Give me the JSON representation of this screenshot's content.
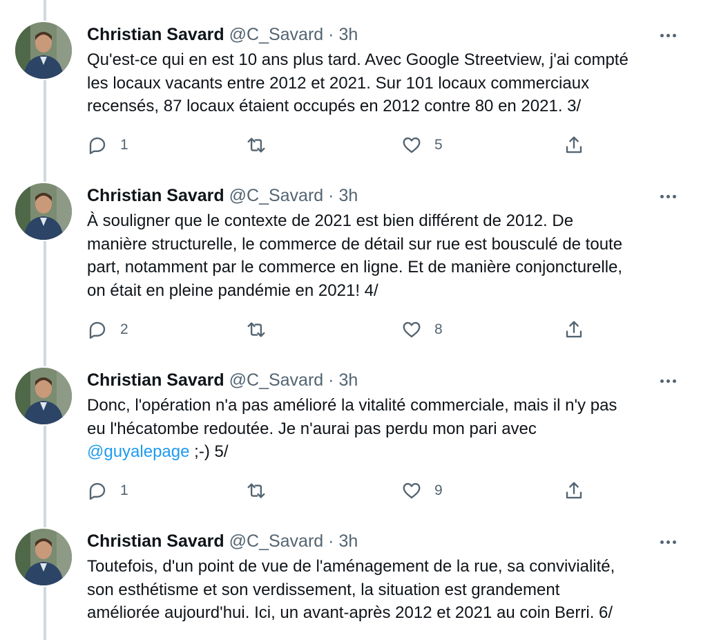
{
  "tweets": [
    {
      "name": "Christian Savard",
      "handle": "@C_Savard",
      "separator": "·",
      "time": "3h",
      "lines": [
        "Qu'est-ce qui en est 10 ans plus tard. Avec Google Streetview, j'ai compté",
        "les locaux vacants entre 2012 et 2021. Sur 101 locaux commerciaux",
        "recensés, 87 locaux étaient occupés en 2012 contre 80 en 2021. 3/"
      ],
      "reply_count": "1",
      "retweet_count": "",
      "like_count": "5"
    },
    {
      "name": "Christian Savard",
      "handle": "@C_Savard",
      "separator": "·",
      "time": "3h",
      "lines": [
        "À souligner que le contexte de 2021 est bien différent de 2012. De",
        "manière structurelle, le commerce de détail sur rue est bousculé de toute",
        "part, notamment par le commerce en ligne. Et de manière conjoncturelle,",
        "on était en pleine pandémie en 2021! 4/"
      ],
      "reply_count": "2",
      "retweet_count": "",
      "like_count": "8"
    },
    {
      "name": "Christian Savard",
      "handle": "@C_Savard",
      "separator": "·",
      "time": "3h",
      "lines": [
        "Donc, l'opération n'a pas amélioré la vitalité commerciale, mais il n'y pas",
        "eu l'hécatombe redoutée. Je n'aurai pas perdu mon pari avec"
      ],
      "mention": "@guyalepage",
      "after_mention": " ;-) 5/",
      "reply_count": "1",
      "retweet_count": "",
      "like_count": "9"
    },
    {
      "name": "Christian Savard",
      "handle": "@C_Savard",
      "separator": "·",
      "time": "3h",
      "lines": [
        "Toutefois, d'un point de vue de l'aménagement de la rue, sa convivialité,",
        "son esthétisme et son verdissement, la situation est grandement",
        "améliorée aujourd'hui. Ici, un avant-après 2012 et 2021 au coin Berri. 6/"
      ]
    }
  ],
  "icons": {
    "reply": "reply-icon",
    "retweet": "retweet-icon",
    "like": "heart-icon",
    "share": "share-icon",
    "more": "more-icon"
  },
  "colors": {
    "text": "#0f1419",
    "secondary": "#536471",
    "link": "#1d9bf0",
    "thread_line": "#cfd9de"
  }
}
